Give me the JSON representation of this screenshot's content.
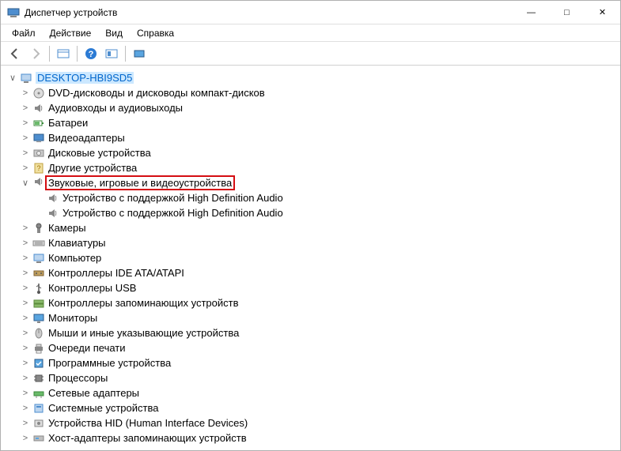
{
  "window": {
    "title": "Диспетчер устройств"
  },
  "menu": {
    "file": "Файл",
    "action": "Действие",
    "view": "Вид",
    "help": "Справка"
  },
  "tree": {
    "root": "DESKTOP-HBI9SD5",
    "items": [
      {
        "label": "DVD-дисководы и дисководы компакт-дисков",
        "icon": "disc"
      },
      {
        "label": "Аудиовходы и аудиовыходы",
        "icon": "speaker"
      },
      {
        "label": "Батареи",
        "icon": "battery"
      },
      {
        "label": "Видеоадаптеры",
        "icon": "display"
      },
      {
        "label": "Дисковые устройства",
        "icon": "disk"
      },
      {
        "label": "Другие устройства",
        "icon": "unknown"
      },
      {
        "label": "Звуковые, игровые и видеоустройства",
        "icon": "speaker",
        "expanded": true,
        "highlighted": true,
        "children": [
          {
            "label": "Устройство с поддержкой High Definition Audio",
            "icon": "speaker"
          },
          {
            "label": "Устройство с поддержкой High Definition Audio",
            "icon": "speaker"
          }
        ]
      },
      {
        "label": "Камеры",
        "icon": "camera"
      },
      {
        "label": "Клавиатуры",
        "icon": "keyboard"
      },
      {
        "label": "Компьютер",
        "icon": "computer"
      },
      {
        "label": "Контроллеры IDE ATA/ATAPI",
        "icon": "ide"
      },
      {
        "label": "Контроллеры USB",
        "icon": "usb"
      },
      {
        "label": "Контроллеры запоминающих устройств",
        "icon": "storage"
      },
      {
        "label": "Мониторы",
        "icon": "monitor"
      },
      {
        "label": "Мыши и иные указывающие устройства",
        "icon": "mouse"
      },
      {
        "label": "Очереди печати",
        "icon": "printer"
      },
      {
        "label": "Программные устройства",
        "icon": "software"
      },
      {
        "label": "Процессоры",
        "icon": "cpu"
      },
      {
        "label": "Сетевые адаптеры",
        "icon": "network"
      },
      {
        "label": "Системные устройства",
        "icon": "system"
      },
      {
        "label": "Устройства HID (Human Interface Devices)",
        "icon": "hid"
      },
      {
        "label": "Хост-адаптеры запоминающих устройств",
        "icon": "host"
      }
    ]
  }
}
